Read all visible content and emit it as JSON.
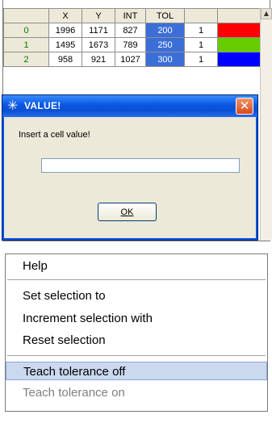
{
  "grid": {
    "headers": [
      "",
      "X",
      "Y",
      "INT",
      "TOL",
      "",
      ""
    ],
    "rows": [
      {
        "idx": "0",
        "x": "1996",
        "y": "1171",
        "int": "827",
        "tol": "200",
        "c6": "1",
        "color": "#ff0000"
      },
      {
        "idx": "1",
        "x": "1495",
        "y": "1673",
        "int": "789",
        "tol": "250",
        "c6": "1",
        "color": "#66cc00"
      },
      {
        "idx": "2",
        "x": "958",
        "y": "921",
        "int": "1027",
        "tol": "300",
        "c6": "1",
        "color": "#0000ff"
      }
    ],
    "scroll_up_glyph": "▲"
  },
  "dialog": {
    "title": "VALUE!",
    "title_icon": "✳",
    "close_glyph": "✕",
    "prompt": "Insert a cell value!",
    "input_value": "",
    "ok_label": "OK"
  },
  "menu": {
    "items": [
      {
        "label": "Help",
        "state": "normal"
      },
      {
        "label": "Set selection to",
        "state": "normal"
      },
      {
        "label": "Increment selection with",
        "state": "normal"
      },
      {
        "label": "Reset selection",
        "state": "normal"
      },
      {
        "label": "Teach tolerance off",
        "state": "highlighted"
      },
      {
        "label": "Teach tolerance on",
        "state": "disabled"
      }
    ]
  },
  "colors": {
    "tol_cell": "#3c6ed8",
    "titlebar": "#0a57e0",
    "menu_highlight": "#cbd9ef"
  }
}
